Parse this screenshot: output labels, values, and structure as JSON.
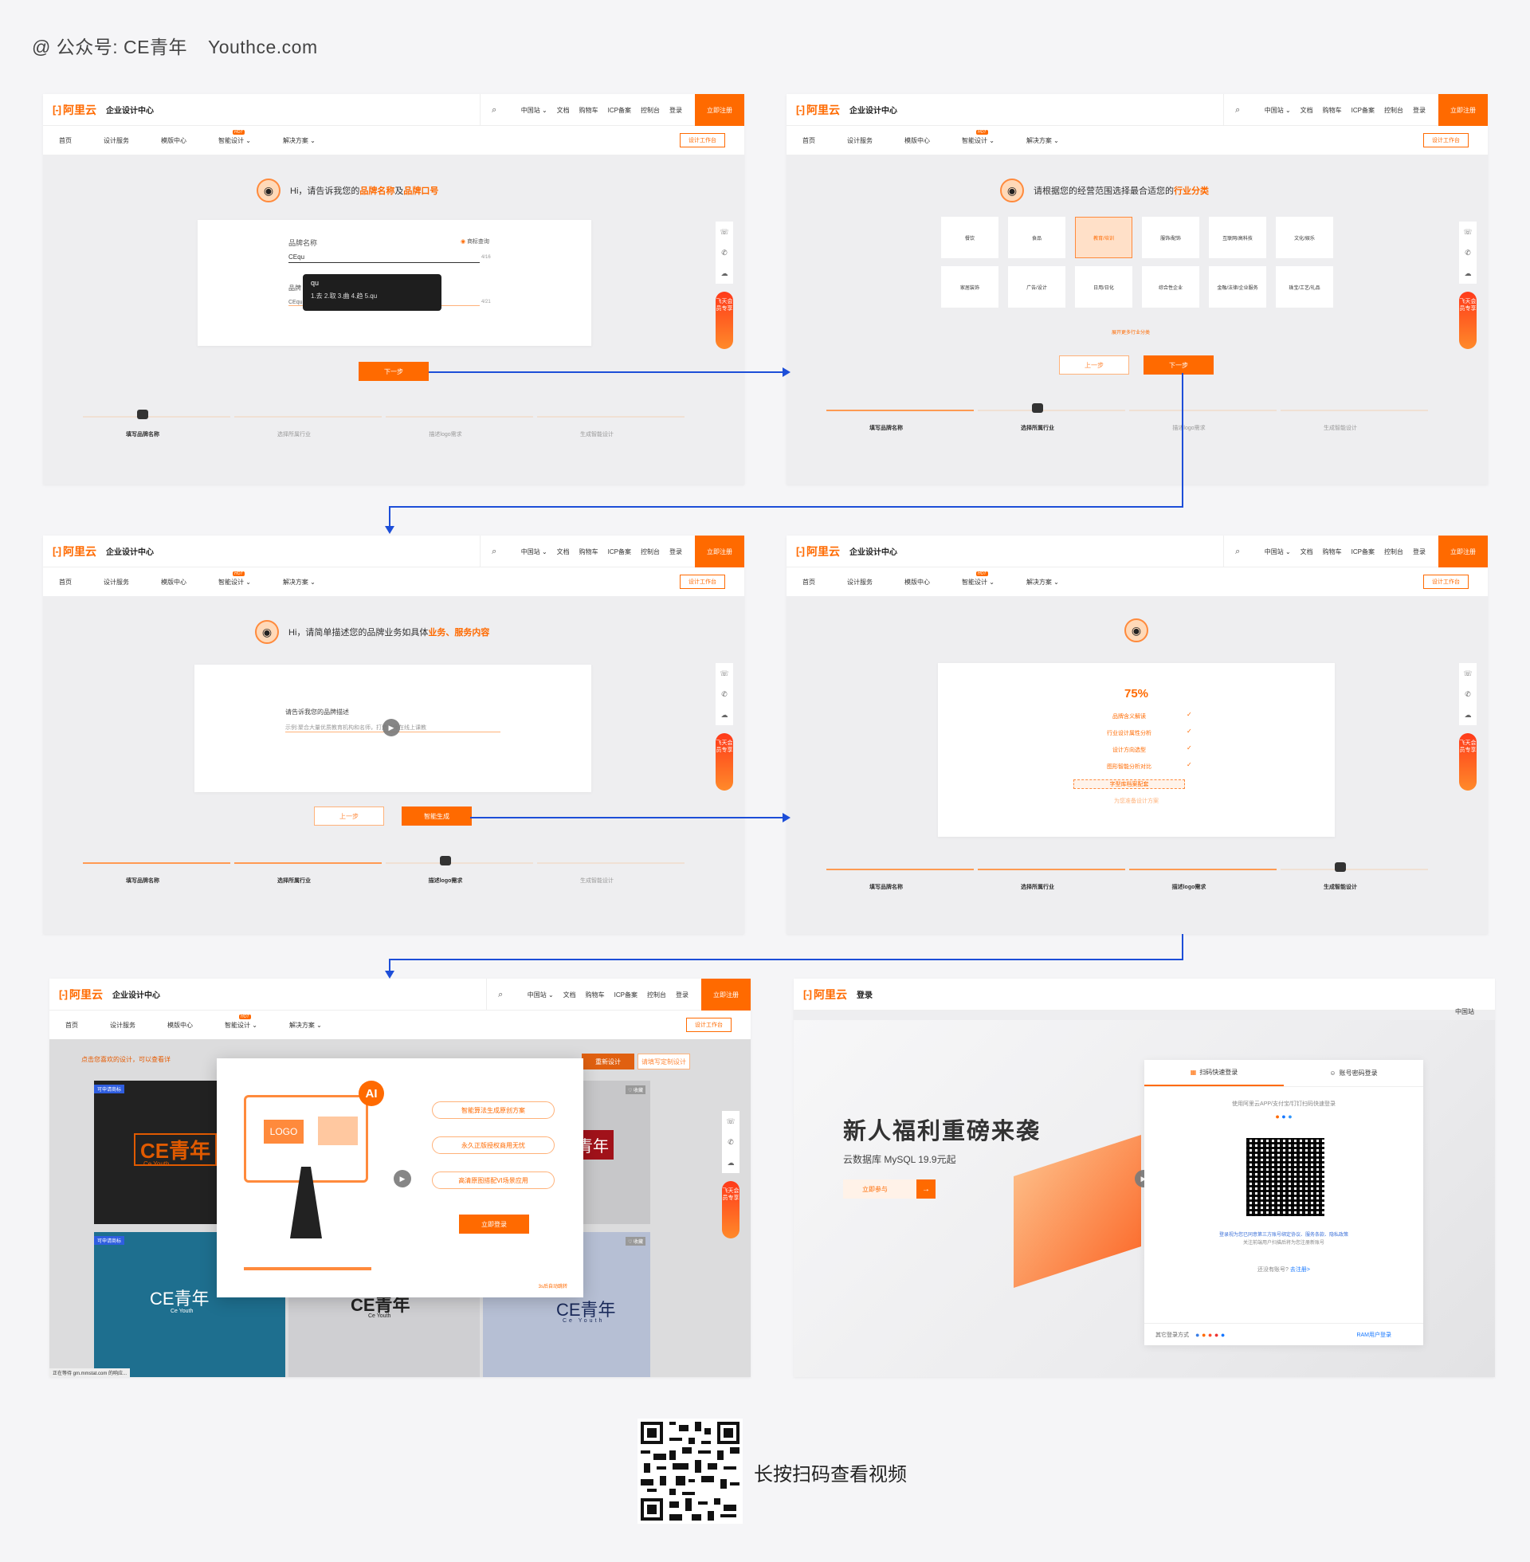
{
  "credit": {
    "account": "@ 公众号: CE青年",
    "site": "Youthce.com"
  },
  "header": {
    "logo_mark": "[-]",
    "logo": "阿里云",
    "site": "企业设计中心",
    "nav": [
      "中国站 ⌄",
      "文档",
      "购物车",
      "ICP备案",
      "控制台",
      "登录"
    ],
    "register": "立即注册",
    "search_icon": "search-icon"
  },
  "subnav": {
    "items": [
      "首页",
      "设计服务",
      "模版中心",
      "智能设计 ⌄",
      "解决方案 ⌄"
    ],
    "hot": "HOT",
    "workbench": "设计工作台"
  },
  "side": {
    "icons": [
      "headset-icon",
      "phone-icon",
      "cloud-icon"
    ],
    "cta": "飞天会员专享"
  },
  "steps": [
    "填写品牌名称",
    "选择所属行业",
    "描述logo需求",
    "生成智能设计"
  ],
  "p1": {
    "greet_a": "Hi，请告诉我您的",
    "greet_b": "品牌名称",
    "greet_c": "及",
    "greet_d": "品牌口号",
    "name_label": "品牌名称",
    "trademark": "商标查询",
    "name_value": "CEqu",
    "name_count": "4/16",
    "slogan_label": "品牌",
    "slogan_value": "CEqu",
    "slogan_count": "4/21",
    "ime_input": "qu",
    "ime_cands": "1.去  2.取  3.曲  4.趋  5.qu",
    "next": "下一步"
  },
  "p2": {
    "greet_a": "请根据您的经营范围选择最合适您的",
    "greet_b": "行业分类",
    "industries": [
      "餐饮",
      "食品",
      "教育/培训",
      "服饰/配饰",
      "互联网/高科技",
      "文化/娱乐",
      "家居装饰",
      "广告/设计",
      "日用/日化",
      "综合性企业",
      "金融/法律/企业服务",
      "珠宝/工艺/礼品"
    ],
    "more": "展开更多行业分类",
    "prev": "上一步",
    "next": "下一步"
  },
  "p3": {
    "greet_a": "Hi，请简单描述您的品牌业务如具体",
    "greet_b": "业务、服务内容",
    "label": "请告诉我您的品牌描述",
    "placeholder": "示例:聚合大量优质教育机构和名师，打造老师在线上课教",
    "prev": "上一步",
    "gen": "智能生成"
  },
  "p4": {
    "percent": "75%",
    "tasks": [
      "品牌含义解读",
      "行业设计属性分析",
      "设计方向选型",
      "图形智能分析对比",
      "字型库档案配套"
    ],
    "preparing": "为您准备设计方案"
  },
  "p5": {
    "banner": "点击您喜欢的设计，可以查看详",
    "redo": "重新设计",
    "custom": "请填写定制设计",
    "badge": "可申请商标",
    "fav": "♡ 收藏",
    "brand": "CE青年",
    "brand_en": "Ce Youth",
    "brand_alt": "青年",
    "modal_benefits": [
      "智能算法生成原创方案",
      "永久正版授权商用无忧",
      "高清原图搭配VI场景应用"
    ],
    "modal_login": "立即登录",
    "modal_ai": "AI",
    "modal_logo": "LOGO",
    "auto": "3s后自动跳转",
    "status": "正在等待 gm.mmstat.com 的响应..."
  },
  "p6": {
    "site": "登录",
    "region": "中国站",
    "promo_title": "新人福利重磅来袭",
    "promo_sub": "云数据库 MySQL 19.9元起",
    "promo_btn": "立即参与",
    "tab_qr": "扫码快速登录",
    "tab_pwd": "账号密码登录",
    "qr_hint": "使用阿里云APP/支付宝/钉钉扫码快速登录",
    "agree": "登录视为您已同意第三方账号绑定协议、服务条款、隐私政策",
    "agree2": "关注前端用户扫描后将为您注册新账号",
    "no_acct": "还没有账号?",
    "signup": "去注册>",
    "other": "其它登录方式",
    "ram": "RAM用户登录"
  },
  "footer": {
    "scan": "长按扫码查看视频"
  }
}
